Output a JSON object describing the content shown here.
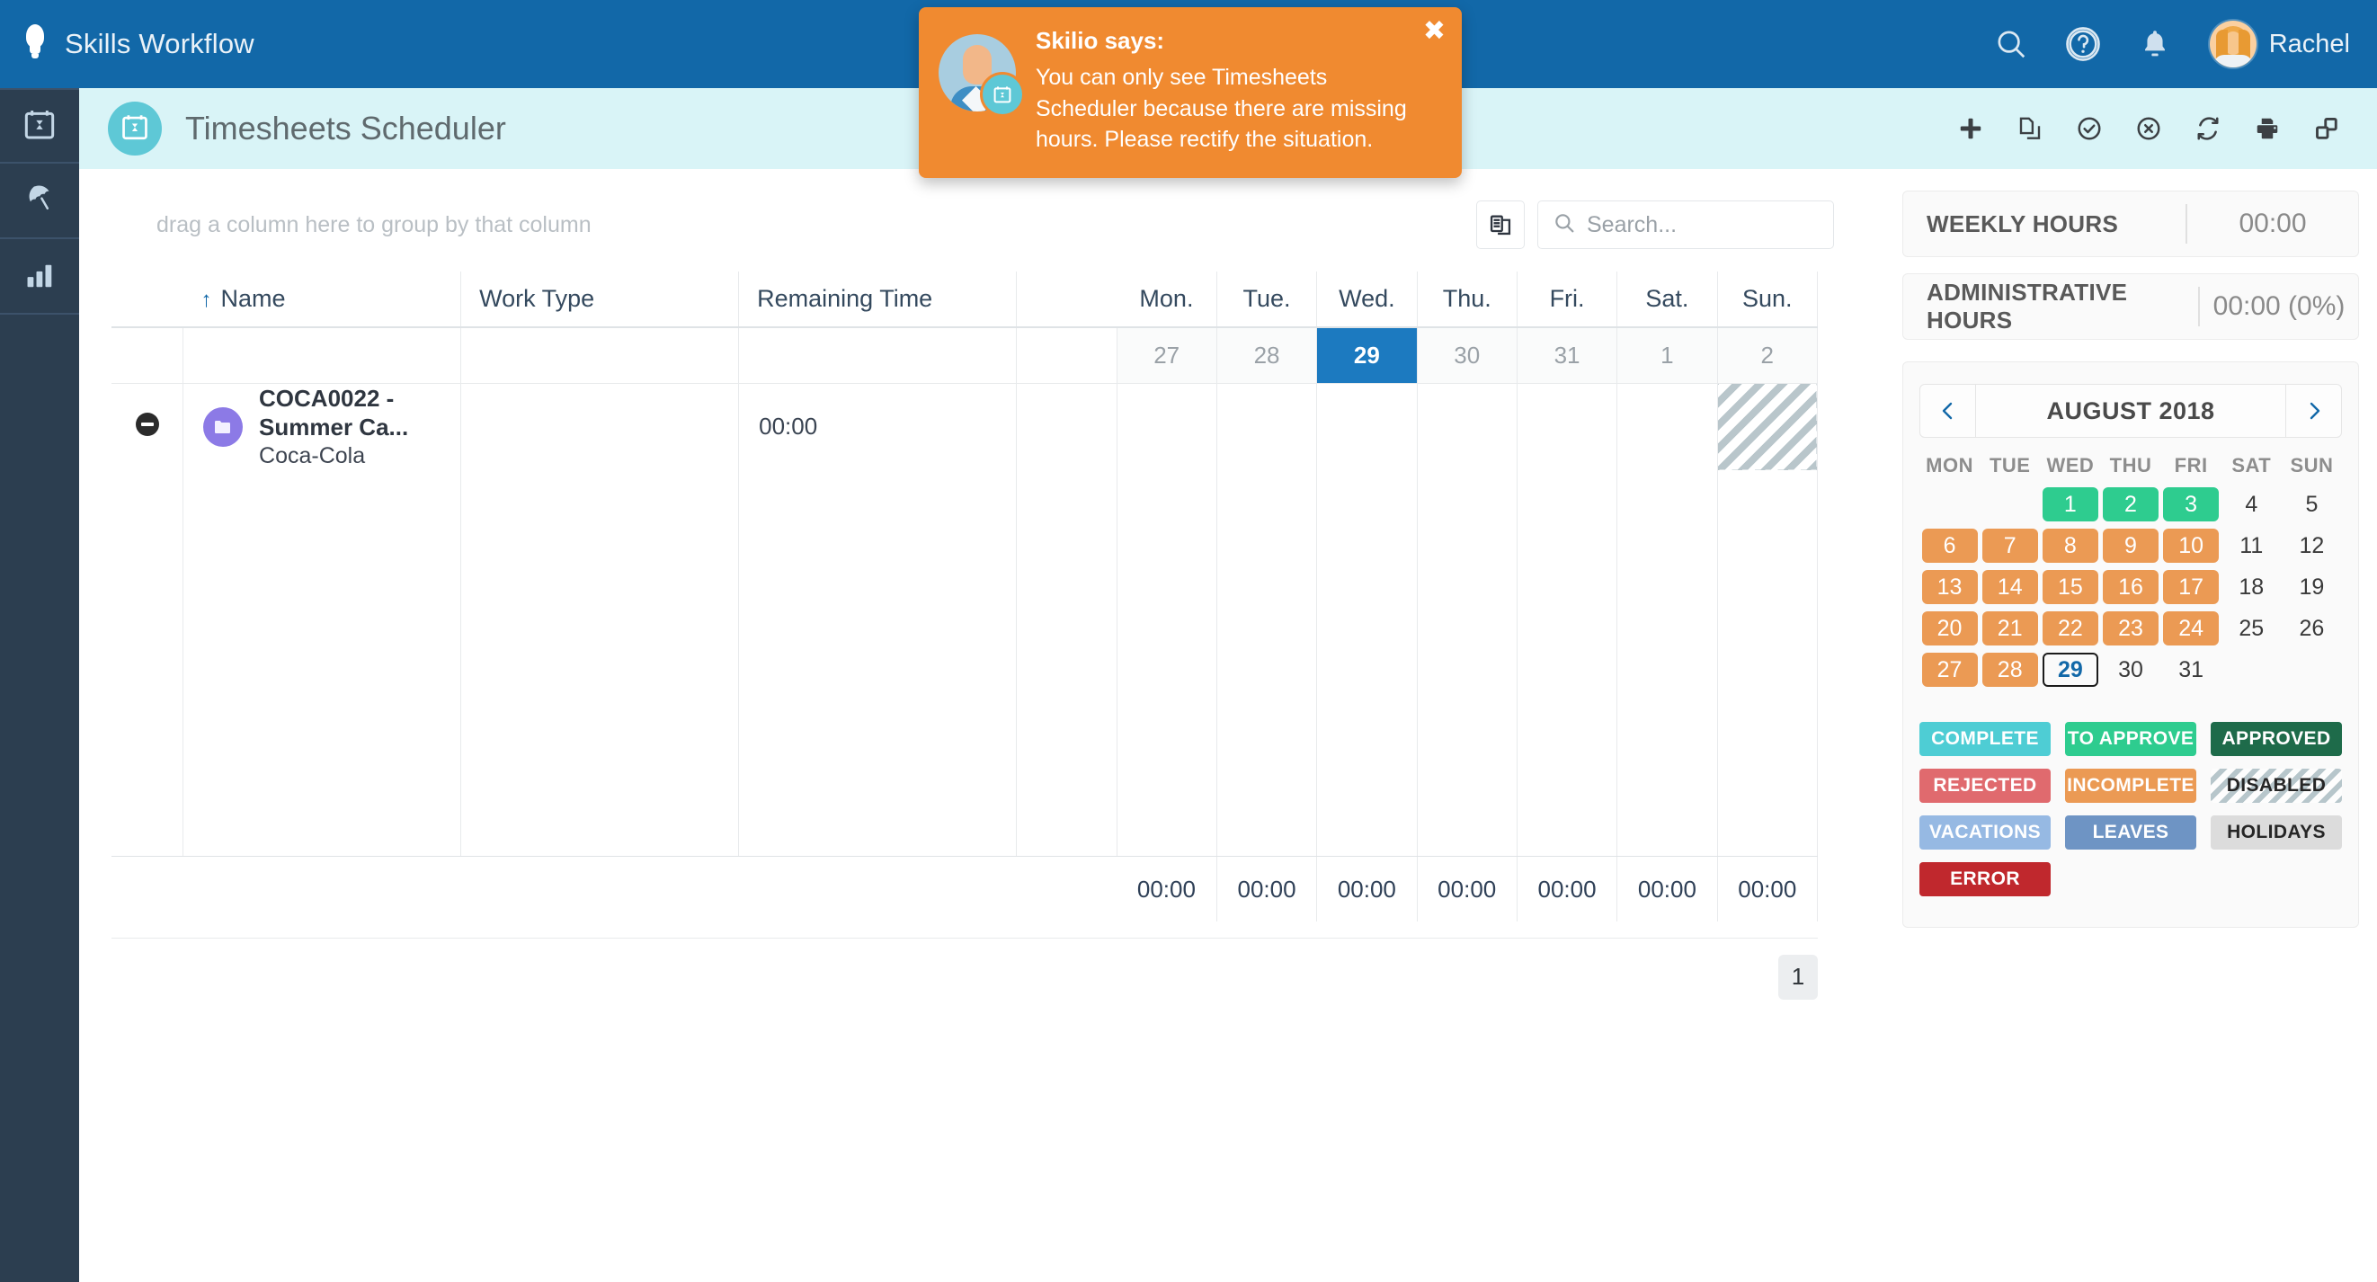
{
  "header": {
    "brand": "Skills Workflow",
    "logo_icon": "lightbulb-icon",
    "search_icon": "search-icon",
    "help_icon": "help-circle-icon",
    "notifications_icon": "bell-icon",
    "user_name": "Rachel",
    "bg_color": "#1268a8"
  },
  "sidebar": {
    "items": [
      {
        "name": "timesheets",
        "icon": "calendar-icon"
      },
      {
        "name": "vacations",
        "icon": "umbrella-icon"
      },
      {
        "name": "reports",
        "icon": "bar-chart-icon"
      }
    ]
  },
  "titlebar": {
    "icon": "calendar-icon",
    "title": "Timesheets Scheduler",
    "bg_color": "#d9f4f7",
    "actions": [
      {
        "name": "add",
        "icon": "plus-icon"
      },
      {
        "name": "copy",
        "icon": "copy-icon"
      },
      {
        "name": "approve",
        "icon": "check-circle-icon"
      },
      {
        "name": "reject",
        "icon": "cancel-circle-icon"
      },
      {
        "name": "refresh",
        "icon": "refresh-icon"
      },
      {
        "name": "print",
        "icon": "print-icon"
      },
      {
        "name": "export",
        "icon": "windows-icon"
      }
    ]
  },
  "notification": {
    "title": "Skilio says:",
    "message": "You can only see Timesheets Scheduler because there are missing hours. Please rectify the situation.",
    "close_label": "✖",
    "bg_color": "#f08a30",
    "avatar_icon": "person-avatar-icon",
    "badge_icon": "calendar-icon"
  },
  "grid": {
    "group_hint": "drag a column here to group by that column",
    "column_chooser_icon": "column-chooser-icon",
    "search": {
      "placeholder": "Search...",
      "value": "",
      "icon": "search-icon"
    },
    "columns": [
      "Name",
      "Work Type",
      "Remaining Time"
    ],
    "sort_indicator": "↑",
    "day_columns": [
      "Mon.",
      "Tue.",
      "Wed.",
      "Thu.",
      "Fri.",
      "Sat.",
      "Sun."
    ],
    "day_numbers": [
      "27",
      "28",
      "29",
      "30",
      "31",
      "1",
      "2"
    ],
    "selected_day_index": 2,
    "rows": [
      {
        "collapse_icon": "minus-circle-icon",
        "badge_icon": "folder-icon",
        "badge_color": "#8c7ae6",
        "title": "COCA0022 - Summer Ca...",
        "subtitle": "Coca-Cola",
        "work_type": "",
        "remaining_time": "00:00",
        "days": [
          "",
          "",
          "",
          "",
          "",
          "",
          ""
        ],
        "disabled_day_index": 6
      }
    ],
    "totals": [
      "00:00",
      "00:00",
      "00:00",
      "00:00",
      "00:00",
      "00:00",
      "00:00"
    ],
    "page": "1"
  },
  "stats": [
    {
      "label": "WEEKLY HOURS",
      "value": "00:00"
    },
    {
      "label": "ADMINISTRATIVE HOURS",
      "value": "00:00 (0%)"
    }
  ],
  "calendar": {
    "prev_icon": "chevron-left-icon",
    "next_icon": "chevron-right-icon",
    "month": "AUGUST 2018",
    "dow": [
      "MON",
      "TUE",
      "WED",
      "THU",
      "FRI",
      "SAT",
      "SUN"
    ],
    "leading_blanks": 2,
    "days": [
      {
        "n": "1",
        "state": "toapprove"
      },
      {
        "n": "2",
        "state": "toapprove"
      },
      {
        "n": "3",
        "state": "toapprove"
      },
      {
        "n": "4",
        "state": "none"
      },
      {
        "n": "5",
        "state": "none"
      },
      {
        "n": "6",
        "state": "incomplete"
      },
      {
        "n": "7",
        "state": "incomplete"
      },
      {
        "n": "8",
        "state": "incomplete"
      },
      {
        "n": "9",
        "state": "incomplete"
      },
      {
        "n": "10",
        "state": "incomplete"
      },
      {
        "n": "11",
        "state": "none"
      },
      {
        "n": "12",
        "state": "none"
      },
      {
        "n": "13",
        "state": "incomplete"
      },
      {
        "n": "14",
        "state": "incomplete"
      },
      {
        "n": "15",
        "state": "incomplete"
      },
      {
        "n": "16",
        "state": "incomplete"
      },
      {
        "n": "17",
        "state": "incomplete"
      },
      {
        "n": "18",
        "state": "none"
      },
      {
        "n": "19",
        "state": "none"
      },
      {
        "n": "20",
        "state": "incomplete"
      },
      {
        "n": "21",
        "state": "incomplete"
      },
      {
        "n": "22",
        "state": "incomplete"
      },
      {
        "n": "23",
        "state": "incomplete"
      },
      {
        "n": "24",
        "state": "incomplete"
      },
      {
        "n": "25",
        "state": "none"
      },
      {
        "n": "26",
        "state": "none"
      },
      {
        "n": "27",
        "state": "incomplete"
      },
      {
        "n": "28",
        "state": "incomplete"
      },
      {
        "n": "29",
        "state": "today"
      },
      {
        "n": "30",
        "state": "none"
      },
      {
        "n": "31",
        "state": "none"
      }
    ],
    "legend": [
      {
        "label": "COMPLETE",
        "color": "#4ecdd4",
        "text": "#ffffff"
      },
      {
        "label": "TO APPROVE",
        "color": "#2ecc8f",
        "text": "#ffffff"
      },
      {
        "label": "APPROVED",
        "color": "#1e6b4a",
        "text": "#ffffff"
      },
      {
        "label": "REJECTED",
        "color": "#e06a6e",
        "text": "#ffffff"
      },
      {
        "label": "INCOMPLETE",
        "color": "#eb9a54",
        "text": "#ffffff"
      },
      {
        "label": "DISABLED",
        "color": "hatch",
        "text": "#262626"
      },
      {
        "label": "VACATIONS",
        "color": "#96b9e3",
        "text": "#ffffff"
      },
      {
        "label": "LEAVES",
        "color": "#6e94c4",
        "text": "#ffffff"
      },
      {
        "label": "HOLIDAYS",
        "color": "#dcdcdc",
        "text": "#262626"
      },
      {
        "label": "ERROR",
        "color": "#c0282d",
        "text": "#ffffff"
      }
    ]
  }
}
